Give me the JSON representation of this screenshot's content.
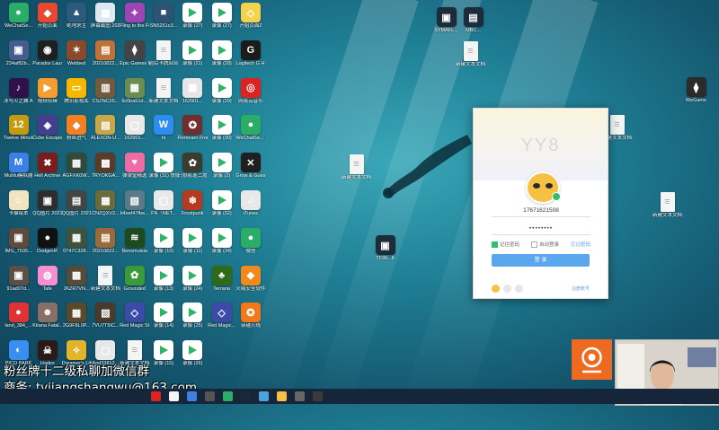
{
  "desktop_icons": [
    {
      "label": "WeChatSe...",
      "color": "#2aae67",
      "glyph": "●"
    },
    {
      "label": "开始页面",
      "color": "#e7482f",
      "glyph": "◆"
    },
    {
      "label": "绝地求生",
      "color": "#2b5a7a",
      "glyph": "▲"
    },
    {
      "label": "屏幕截图 2021082...",
      "color": "#dfe7ef",
      "glyph": "▦"
    },
    {
      "label": "Fling to the Finish 修改",
      "color": "#9f43b5",
      "glyph": "✦"
    },
    {
      "label": "SN5251c3...",
      "color": "#2c5376",
      "glyph": "■"
    },
    {
      "label": "录像 (27)",
      "color": "#ffffff",
      "glyph": "",
      "play": true
    },
    {
      "label": "录像 (27)",
      "color": "#ffffff",
      "glyph": "",
      "play": true
    },
    {
      "label": "开始页面2",
      "color": "#f3d34c",
      "glyph": "◇"
    },
    {
      "label": "234af82b...",
      "color": "#475c8e",
      "glyph": "▣"
    },
    {
      "label": "Paradox Launcher v2",
      "color": "#1f1f1f",
      "glyph": "◉"
    },
    {
      "label": "Webbed",
      "color": "#8a4a29",
      "glyph": "✶"
    },
    {
      "label": "20210822...",
      "color": "#c07236",
      "glyph": "▤"
    },
    {
      "label": "Epic Games WeGame版",
      "color": "#444",
      "glyph": "⧫"
    },
    {
      "label": "前后卡牌回合",
      "color": "#f5f5f5",
      "glyph": "",
      "doc": true
    },
    {
      "label": "录像 (21)",
      "color": "#ffffff",
      "glyph": "",
      "play": true
    },
    {
      "label": "录像 (28)",
      "color": "#ffffff",
      "glyph": "",
      "play": true
    },
    {
      "label": "Logitech G HUB",
      "color": "#1b1b1b",
      "glyph": "G"
    },
    {
      "label": "冰与火之舞 A Dance of...",
      "color": "#301048",
      "glyph": "♪"
    },
    {
      "label": "视频剪辑",
      "color": "#f59e2f",
      "glyph": "▶"
    },
    {
      "label": "腾讯影视库",
      "color": "#f6b700",
      "glyph": "▭"
    },
    {
      "label": "CSZNC25...",
      "color": "#735a3c",
      "glyph": "▥"
    },
    {
      "label": "6c6ba51d...",
      "color": "#6a8e52",
      "glyph": "▦"
    },
    {
      "label": "新建文本文档 (2)",
      "color": "#f5f5f5",
      "glyph": "",
      "doc": true
    },
    {
      "label": "162901...",
      "color": "#e6e6e6",
      "glyph": "▣"
    },
    {
      "label": "录像 (29)",
      "color": "#ffffff",
      "glyph": "",
      "play": true
    },
    {
      "label": "网易云音乐",
      "color": "#dd2222",
      "glyph": "◎"
    },
    {
      "label": "Twelve Minutes",
      "color": "#c59a10",
      "glyph": "12"
    },
    {
      "label": "Cube Escape...",
      "color": "#463d91",
      "glyph": "◈"
    },
    {
      "label": "粉丝进气",
      "color": "#f27f22",
      "glyph": "◆"
    },
    {
      "label": "ALEXON-U...",
      "color": "#c9a64c",
      "glyph": "▤"
    },
    {
      "label": "162901...",
      "color": "#e8e8e8",
      "glyph": "▢"
    },
    {
      "label": "hi",
      "color": "#2d8cf0",
      "glyph": "W"
    },
    {
      "label": "Remnant From t...",
      "color": "#722d2d",
      "glyph": "✪"
    },
    {
      "label": "录像 (30)",
      "color": "#ffffff",
      "glyph": "",
      "play": true
    },
    {
      "label": "WeChatSe... (2)",
      "color": "#2aae67",
      "glyph": "●"
    },
    {
      "label": "MuMu模拟器",
      "color": "#3c80e6",
      "glyph": "M"
    },
    {
      "label": "Hell Archive",
      "color": "#7a1d1d",
      "glyph": "✖"
    },
    {
      "label": "AGFXK0W...",
      "color": "#334a3b",
      "glyph": "▦"
    },
    {
      "label": "7RYOKGA...",
      "color": "#5a3b2a",
      "glyph": "▩"
    },
    {
      "label": "弹弹堂精选",
      "color": "#f06ba4",
      "glyph": "♥"
    },
    {
      "label": "录像 (31) 快捷方式",
      "color": "#ffffff",
      "glyph": "",
      "play": true
    },
    {
      "label": "只狼影逝二度",
      "color": "#3b3b30",
      "glyph": "✿"
    },
    {
      "label": "录像 (2)",
      "color": "#ffffff",
      "glyph": "",
      "play": true
    },
    {
      "label": "Grow & Guess",
      "color": "#1f1f1f",
      "glyph": "✕"
    },
    {
      "label": "卡猫绘本",
      "color": "#f3e4c1",
      "glyph": "☺"
    },
    {
      "label": "QQ图片 20210818...",
      "color": "#2e2e2e",
      "glyph": "▣"
    },
    {
      "label": "QQ图片 20210819...",
      "color": "#444",
      "glyph": "▤"
    },
    {
      "label": "CNZQXV2...",
      "color": "#6b6b3c",
      "glyph": "▦"
    },
    {
      "label": "b4eef47fbe...",
      "color": "#5a7a8a",
      "glyph": "▧"
    },
    {
      "label": "FN「NET...",
      "color": "#e9e9e9",
      "glyph": "▢"
    },
    {
      "label": "Frostpunk",
      "color": "#b53a1f",
      "glyph": "❄"
    },
    {
      "label": "录像 (32)",
      "color": "#ffffff",
      "glyph": "",
      "play": true
    },
    {
      "label": "iTunes",
      "color": "#e8e8e8",
      "glyph": "♫"
    },
    {
      "label": "IMG_7535...",
      "color": "#5d4a3a",
      "glyph": "▣"
    },
    {
      "label": "DodgeHF",
      "color": "#111111",
      "glyph": "●"
    },
    {
      "label": "0747C328...",
      "color": "#40533a",
      "glyph": "▦"
    },
    {
      "label": "20210822...",
      "color": "#9a6a3a",
      "glyph": "▤"
    },
    {
      "label": "Bensmulsia",
      "color": "#1f4a1f",
      "glyph": "≋"
    },
    {
      "label": "录像 (10)",
      "color": "#ffffff",
      "glyph": "",
      "play": true
    },
    {
      "label": "录像 (11)",
      "color": "#ffffff",
      "glyph": "",
      "play": true
    },
    {
      "label": "录像 (34)",
      "color": "#ffffff",
      "glyph": "",
      "play": true
    },
    {
      "label": "微信",
      "color": "#2aae67",
      "glyph": "●"
    },
    {
      "label": "91ad07d...",
      "color": "#5a5048",
      "glyph": "▣"
    },
    {
      "label": "Tafe",
      "color": "#f58fd1",
      "glyph": "◍"
    },
    {
      "label": "JKZR7VN...",
      "color": "#584a3a",
      "glyph": "▦"
    },
    {
      "label": "新建文本文档 (4)",
      "color": "#f5f5f5",
      "glyph": "",
      "doc": true
    },
    {
      "label": "Grounded",
      "color": "#3a9a3a",
      "glyph": "✿"
    },
    {
      "label": "录像 (13)",
      "color": "#ffffff",
      "glyph": "",
      "play": true
    },
    {
      "label": "录像 (24)",
      "color": "#ffffff",
      "glyph": "",
      "play": true
    },
    {
      "label": "Terraria",
      "color": "#2d6a1a",
      "glyph": "♣"
    },
    {
      "label": "火绒安全软件",
      "color": "#f08a1d",
      "glyph": "◆"
    },
    {
      "label": "land_384_...",
      "color": "#d33",
      "glyph": "●"
    },
    {
      "label": "Kitana Fatal...",
      "color": "#887066",
      "glyph": "☻"
    },
    {
      "label": "2G9F8L0P...",
      "color": "#5a4a2a",
      "glyph": "▦"
    },
    {
      "label": "7VU7T5IC...",
      "color": "#4a3a2a",
      "glyph": "▧"
    },
    {
      "label": "Red Magic Studio",
      "color": "#3c4aa8",
      "glyph": "◇"
    },
    {
      "label": "录像 (14)",
      "color": "#ffffff",
      "glyph": "",
      "play": true
    },
    {
      "label": "录像 (25)",
      "color": "#ffffff",
      "glyph": "",
      "play": true
    },
    {
      "label": "Red Magic...",
      "color": "#3c4aa8",
      "glyph": "◇"
    },
    {
      "label": "穿越火线",
      "color": "#f07a1a",
      "glyph": "✪"
    },
    {
      "label": "PICO PARK",
      "color": "#3a8ef0",
      "glyph": "◐"
    },
    {
      "label": "Hades",
      "color": "#2a1a1a",
      "glyph": "☠"
    },
    {
      "label": "Dreamer's Life",
      "color": "#e2b42a",
      "glyph": "✧"
    },
    {
      "label": "And33812...",
      "color": "#e8e8e8",
      "glyph": "▢"
    },
    {
      "label": "新建文本文档 (3)",
      "color": "#f5f5f5",
      "glyph": "",
      "doc": true
    },
    {
      "label": "录像 (15)",
      "color": "#ffffff",
      "glyph": "",
      "play": true
    },
    {
      "label": "录像 (26)",
      "color": "#ffffff",
      "glyph": "",
      "play": true
    }
  ],
  "top_right_icons": [
    {
      "label": "SYMAFL...",
      "color": "#1d2c3a",
      "glyph": "▣"
    },
    {
      "label": "MBC...",
      "color": "#1d2c3a",
      "glyph": "▤"
    }
  ],
  "scattered_docs": [
    {
      "label": "新建文本文档 (8)"
    },
    {
      "label": "新建文本文档 (1)"
    },
    {
      "label": "新建文本文档 (7)"
    },
    {
      "label": "新建文本文档"
    }
  ],
  "center_icon": {
    "label": "TF99...8"
  },
  "right_icon": {
    "label": "WeGame"
  },
  "login": {
    "title": "YY8",
    "username": "17671621508",
    "password": "••••••••",
    "remember": "记住密码",
    "auto": "自动登录",
    "forgot": "忘记密码",
    "login_btn": "登 录",
    "register": "注册账号"
  },
  "overlay": {
    "line1": "粉丝牌十二级私聊加微信群",
    "line2": "商务: tyjiangshangwu@163.com"
  },
  "colors": {
    "accent": "#5ba7ee",
    "overlay_orange": "#ef6a21"
  }
}
